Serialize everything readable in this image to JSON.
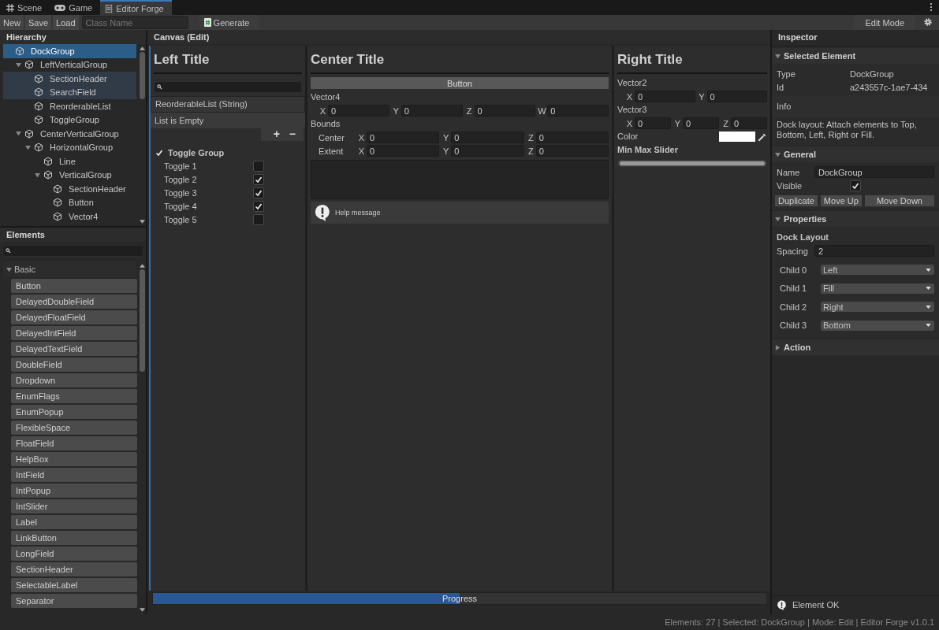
{
  "tabs": [
    {
      "label": "Scene",
      "selected": false
    },
    {
      "label": "Game",
      "selected": false
    },
    {
      "label": "Editor Forge",
      "selected": true
    }
  ],
  "toolbar": {
    "buttons": [
      "New",
      "Save",
      "Load"
    ],
    "class_field": {
      "placeholder": "Class Name"
    },
    "generate": "Generate",
    "mode": "Edit Mode"
  },
  "hierarchy": {
    "title": "Hierarchy",
    "items": [
      {
        "label": "DockGroup",
        "selected": true,
        "highlighted": false,
        "children": [
          {
            "label": "LeftVerticalGroup",
            "selected": false,
            "highlighted": false,
            "expanded": true,
            "children": [
              {
                "label": "SectionHeader",
                "selected": false,
                "highlighted": true
              },
              {
                "label": "SearchField",
                "selected": false,
                "highlighted": true
              },
              {
                "label": "ReorderableList",
                "selected": false,
                "highlighted": false
              },
              {
                "label": "ToggleGroup",
                "selected": false,
                "highlighted": false
              }
            ]
          },
          {
            "label": "CenterVerticalGroup",
            "selected": false,
            "highlighted": false,
            "expanded": true,
            "children": [
              {
                "label": "HorizontalGroup",
                "selected": false,
                "highlighted": false,
                "expanded": true,
                "children": [
                  {
                    "label": "Line",
                    "selected": false,
                    "highlighted": false
                  },
                  {
                    "label": "VerticalGroup",
                    "selected": false,
                    "highlighted": false,
                    "expanded": true,
                    "children": [
                      {
                        "label": "SectionHeader",
                        "selected": false,
                        "highlighted": false
                      },
                      {
                        "label": "Button",
                        "selected": false,
                        "highlighted": false
                      },
                      {
                        "label": "Vector4",
                        "selected": false,
                        "highlighted": false
                      }
                    ]
                  }
                ]
              }
            ]
          }
        ]
      }
    ]
  },
  "elements": {
    "title": "Elements",
    "category": {
      "label": "Basic",
      "expanded": true
    },
    "items": [
      "Button",
      "DelayedDoubleField",
      "DelayedFloatField",
      "DelayedIntField",
      "DelayedTextField",
      "DoubleField",
      "Dropdown",
      "EnumFlags",
      "EnumPopup",
      "FlexibleSpace",
      "FloatField",
      "HelpBox",
      "IntField",
      "IntPopup",
      "IntSlider",
      "Label",
      "LinkButton",
      "LongField",
      "SectionHeader",
      "SelectableLabel",
      "Separator"
    ]
  },
  "canvas": {
    "title": "Canvas (Edit)",
    "left": {
      "title": "Left Title",
      "list_header": "ReorderableList (String)",
      "list_empty": "List is Empty",
      "add_label": "+",
      "remove_label": "−",
      "toggle_group": {
        "label": "Toggle Group",
        "checked": true,
        "toggles": [
          {
            "label": "Toggle 1",
            "checked": false
          },
          {
            "label": "Toggle 2",
            "checked": true
          },
          {
            "label": "Toggle 3",
            "checked": true
          },
          {
            "label": "Toggle 4",
            "checked": true
          },
          {
            "label": "Toggle 5",
            "checked": false
          }
        ]
      }
    },
    "center": {
      "title": "Center Title",
      "button": "Button",
      "vector4": {
        "label": "Vector4",
        "fields": [
          {
            "axis": "X",
            "value": "0"
          },
          {
            "axis": "Y",
            "value": "0"
          },
          {
            "axis": "Z",
            "value": "0"
          },
          {
            "axis": "W",
            "value": "0"
          }
        ]
      },
      "bounds": {
        "label": "Bounds",
        "rows": [
          {
            "label": "Center",
            "fields": [
              {
                "axis": "X",
                "value": "0"
              },
              {
                "axis": "Y",
                "value": "0"
              },
              {
                "axis": "Z",
                "value": "0"
              }
            ]
          },
          {
            "label": "Extent",
            "fields": [
              {
                "axis": "X",
                "value": "0"
              },
              {
                "axis": "Y",
                "value": "0"
              },
              {
                "axis": "Z",
                "value": "0"
              }
            ]
          }
        ]
      },
      "help": "Help message"
    },
    "right": {
      "title": "Right Title",
      "vector2": {
        "label": "Vector2",
        "fields": [
          {
            "axis": "X",
            "value": "0"
          },
          {
            "axis": "Y",
            "value": "0"
          }
        ]
      },
      "vector3": {
        "label": "Vector3",
        "fields": [
          {
            "axis": "X",
            "value": "0"
          },
          {
            "axis": "Y",
            "value": "0"
          },
          {
            "axis": "Z",
            "value": "0"
          }
        ]
      },
      "color": {
        "label": "Color",
        "color": "#ffffff"
      },
      "slider": {
        "label": "Min Max Slider",
        "level": 1
      }
    },
    "progress": {
      "label": "Progress",
      "level": 0.5
    }
  },
  "inspector": {
    "title": "Inspector",
    "selected_section": {
      "title": "Selected Element",
      "expanded": true,
      "rows": [
        {
          "label": "Type",
          "value": "DockGroup"
        },
        {
          "label": "Id",
          "value": "a243557c-1ae7-434"
        }
      ],
      "info_label": "Info",
      "info": "Dock layout: Attach elements to Top, Bottom, Left, Right or Fill."
    },
    "general": {
      "title": "General",
      "expanded": true,
      "name_label": "Name",
      "name_value": "DockGroup",
      "visible_label": "Visible",
      "visible": true,
      "buttons": [
        "Duplicate",
        "Move Up",
        "Move Down"
      ]
    },
    "properties": {
      "title": "Properties",
      "expanded": true,
      "subtitle": "Dock Layout",
      "spacing_label": "Spacing",
      "spacing": "2",
      "children": [
        {
          "label": "Child 0",
          "value": "Left"
        },
        {
          "label": "Child 1",
          "value": "Fill"
        },
        {
          "label": "Child 2",
          "value": "Right"
        },
        {
          "label": "Child 3",
          "value": "Bottom"
        }
      ]
    },
    "action": {
      "title": "Action",
      "expanded": false
    },
    "status": "Element OK"
  },
  "status_bar": "Elements: 27 | Selected: DockGroup | Mode: Edit | Editor Forge v1.0.1"
}
